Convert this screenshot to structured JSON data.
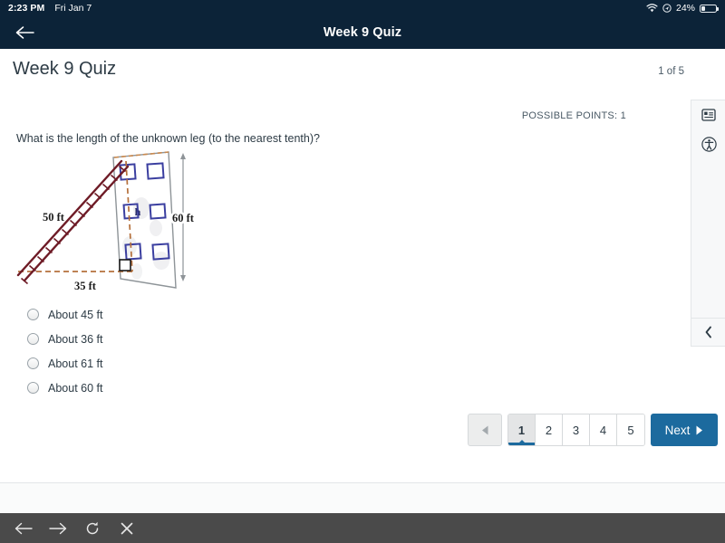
{
  "status_bar": {
    "time": "2:23 PM",
    "date": "Fri Jan 7",
    "battery_percent": "24%",
    "wifi_icon": "wifi-icon",
    "location_icon": "location-services-icon",
    "battery_icon": "battery-icon"
  },
  "nav": {
    "back_icon": "arrow-left-icon",
    "title": "Week 9 Quiz"
  },
  "header": {
    "quiz_title": "Week 9 Quiz",
    "page_counter": "1 of 5"
  },
  "question": {
    "possible_points": "POSSIBLE POINTS: 1",
    "text": "What is the length of the unknown leg (to the nearest tenth)?",
    "diagram": {
      "ladder_label": "50 ft",
      "ground_label": "35 ft",
      "height_label": "60 ft",
      "unknown_label": "h",
      "window_count": 6,
      "ladder_color": "#6e1b26",
      "dashed_color": "#b5703c",
      "window_color": "#3b3fa0",
      "wall_color": "#8e9498"
    },
    "answers": [
      {
        "label": "About 45 ft",
        "selected": false
      },
      {
        "label": "About 36 ft",
        "selected": false
      },
      {
        "label": "About 61 ft",
        "selected": false
      },
      {
        "label": "About 60 ft",
        "selected": false
      }
    ]
  },
  "rail": {
    "outline_icon": "question-list-icon",
    "accessibility_icon": "accessibility-icon",
    "collapse_icon": "chevron-left-icon"
  },
  "pager": {
    "prev_icon": "triangle-left-icon",
    "pages": [
      "1",
      "2",
      "3",
      "4",
      "5"
    ],
    "active_page": "1",
    "next_label": "Next",
    "next_icon": "triangle-right-icon"
  },
  "browser_bar": {
    "back_icon": "arrow-left-icon",
    "forward_icon": "arrow-right-icon",
    "reload_icon": "reload-icon",
    "close_icon": "close-x-icon"
  },
  "colors": {
    "nav_bg": "#0c2338",
    "accent": "#1c6a9e",
    "text": "#2d3b45",
    "muted": "#4a5a66",
    "browser_bar_bg": "#4a4a4a"
  }
}
